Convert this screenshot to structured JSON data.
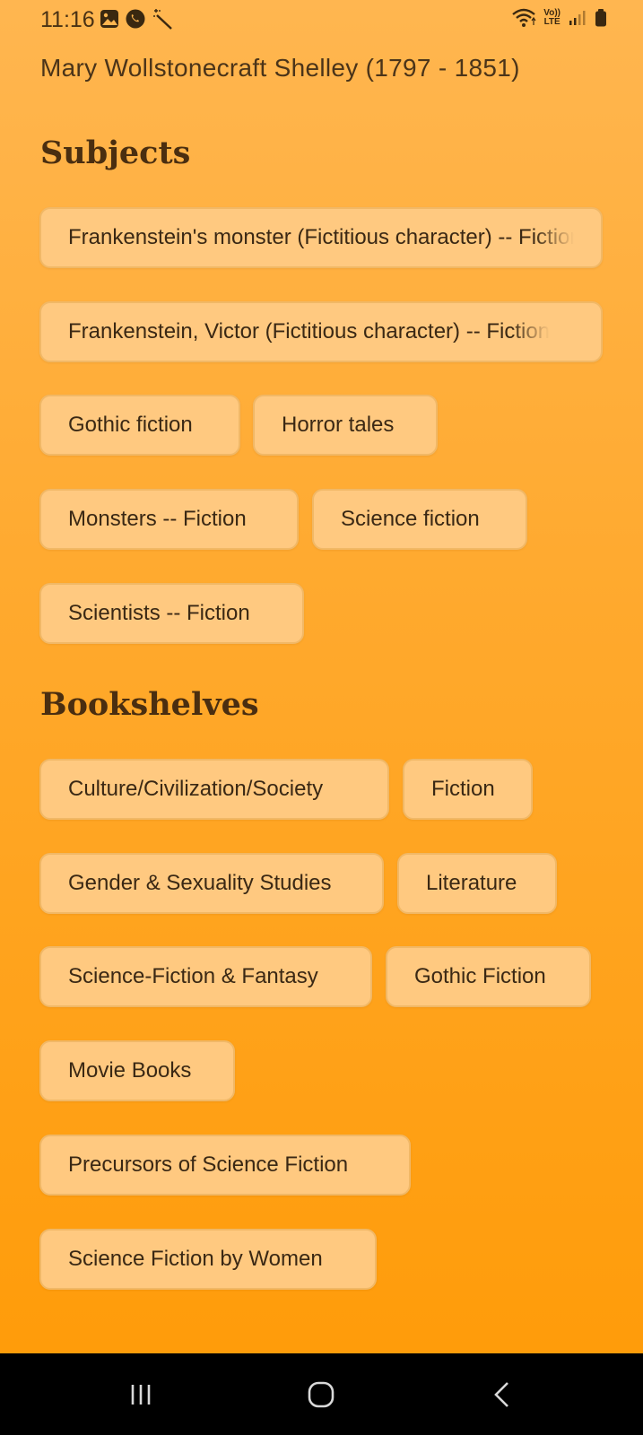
{
  "status_bar": {
    "time": "11:16",
    "volte_label": "Vo))",
    "lte_label": "LTE"
  },
  "author": "Mary Wollstonecraft Shelley (1797 - 1851)",
  "subjects": {
    "title": "Subjects",
    "items": [
      "Frankenstein's monster (Fictitious character) -- Fiction",
      "Frankenstein, Victor (Fictitious character) -- Fiction",
      "Gothic fiction",
      "Horror tales",
      "Monsters -- Fiction",
      "Science fiction",
      "Scientists -- Fiction"
    ]
  },
  "bookshelves": {
    "title": "Bookshelves",
    "items": [
      "Culture/Civilization/Society",
      "Fiction",
      "Gender & Sexuality Studies",
      "Literature",
      "Science-Fiction & Fantasy",
      "Gothic Fiction",
      "Movie Books",
      "Precursors of Science Fiction",
      "Science Fiction by Women"
    ]
  },
  "colors": {
    "background_top": "#ffb650",
    "background_bottom": "#ff9c0a",
    "chip_fill": "#ffc980",
    "chip_border": "#f1b866",
    "text": "#3a2814",
    "nav_bar": "#000000"
  },
  "icons": [
    "gallery-icon",
    "whatsapp-icon",
    "magic-wand-icon",
    "wifi-icon",
    "volte-lte-icon",
    "signal-icon",
    "battery-icon",
    "recents-icon",
    "home-icon",
    "back-icon"
  ]
}
